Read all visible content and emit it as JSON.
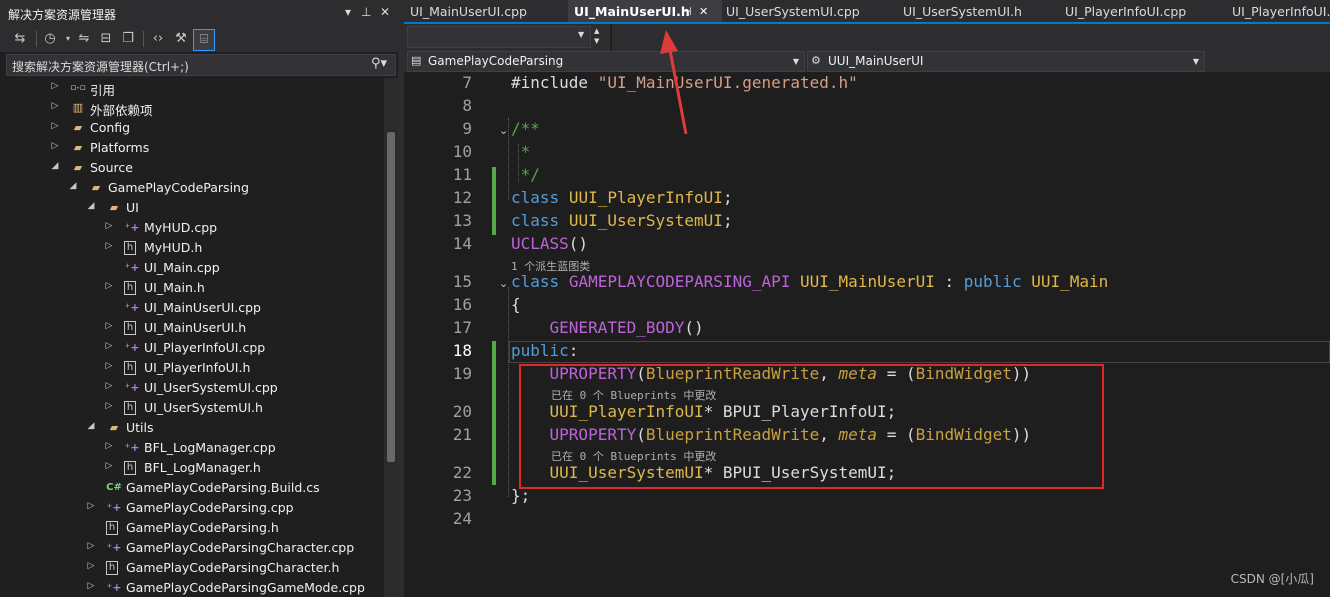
{
  "solution_explorer": {
    "title": "解决方案资源管理器",
    "search_placeholder": "搜索解决方案资源管理器(Ctrl+;)",
    "tree": [
      {
        "label": "引用",
        "icon": "reference-icon",
        "indent": 0,
        "expand": "collapsed"
      },
      {
        "label": "外部依赖项",
        "icon": "external-deps-icon",
        "indent": 0,
        "expand": "collapsed"
      },
      {
        "label": "Config",
        "icon": "folder-icon",
        "indent": 0,
        "expand": "collapsed"
      },
      {
        "label": "Platforms",
        "icon": "folder-icon",
        "indent": 0,
        "expand": "collapsed"
      },
      {
        "label": "Source",
        "icon": "folder-icon",
        "indent": 0,
        "expand": "expanded"
      },
      {
        "label": "GamePlayCodeParsing",
        "icon": "folder-icon",
        "indent": 1,
        "expand": "expanded"
      },
      {
        "label": "UI",
        "icon": "folder-icon",
        "indent": 2,
        "expand": "expanded"
      },
      {
        "label": "MyHUD.cpp",
        "icon": "cpp-file-icon",
        "indent": 3,
        "expand": "collapsed"
      },
      {
        "label": "MyHUD.h",
        "icon": "header-file-icon",
        "indent": 3,
        "expand": "collapsed"
      },
      {
        "label": "UI_Main.cpp",
        "icon": "cpp-file-icon",
        "indent": 3,
        "expand": "none"
      },
      {
        "label": "UI_Main.h",
        "icon": "header-file-icon",
        "indent": 3,
        "expand": "collapsed"
      },
      {
        "label": "UI_MainUserUI.cpp",
        "icon": "cpp-file-icon",
        "indent": 3,
        "expand": "none"
      },
      {
        "label": "UI_MainUserUI.h",
        "icon": "header-file-icon",
        "indent": 3,
        "expand": "collapsed"
      },
      {
        "label": "UI_PlayerInfoUI.cpp",
        "icon": "cpp-file-icon",
        "indent": 3,
        "expand": "collapsed"
      },
      {
        "label": "UI_PlayerInfoUI.h",
        "icon": "header-file-icon",
        "indent": 3,
        "expand": "collapsed"
      },
      {
        "label": "UI_UserSystemUI.cpp",
        "icon": "cpp-file-icon",
        "indent": 3,
        "expand": "collapsed"
      },
      {
        "label": "UI_UserSystemUI.h",
        "icon": "header-file-icon",
        "indent": 3,
        "expand": "collapsed"
      },
      {
        "label": "Utils",
        "icon": "folder-icon",
        "indent": 2,
        "expand": "expanded"
      },
      {
        "label": "BFL_LogManager.cpp",
        "icon": "cpp-file-icon",
        "indent": 3,
        "expand": "collapsed"
      },
      {
        "label": "BFL_LogManager.h",
        "icon": "header-file-icon",
        "indent": 3,
        "expand": "collapsed"
      },
      {
        "label": "GamePlayCodeParsing.Build.cs",
        "icon": "csharp-file-icon",
        "indent": 2,
        "expand": "none"
      },
      {
        "label": "GamePlayCodeParsing.cpp",
        "icon": "cpp-file-icon",
        "indent": 2,
        "expand": "collapsed"
      },
      {
        "label": "GamePlayCodeParsing.h",
        "icon": "header-file-icon",
        "indent": 2,
        "expand": "none"
      },
      {
        "label": "GamePlayCodeParsingCharacter.cpp",
        "icon": "cpp-file-icon",
        "indent": 2,
        "expand": "collapsed"
      },
      {
        "label": "GamePlayCodeParsingCharacter.h",
        "icon": "header-file-icon",
        "indent": 2,
        "expand": "collapsed"
      },
      {
        "label": "GamePlayCodeParsingGameMode.cpp",
        "icon": "cpp-file-icon",
        "indent": 2,
        "expand": "collapsed"
      }
    ]
  },
  "tabs": [
    {
      "label": "UI_MainUserUI.cpp",
      "active": false
    },
    {
      "label": "UI_MainUserUI.h",
      "active": true
    },
    {
      "label": "UI_UserSystemUI.cpp",
      "active": false
    },
    {
      "label": "UI_UserSystemUI.h",
      "active": false
    },
    {
      "label": "UI_PlayerInfoUI.cpp",
      "active": false
    },
    {
      "label": "UI_PlayerInfoUI.h",
      "active": false
    }
  ],
  "nav": {
    "project": "GamePlayCodeParsing",
    "scope": "UUI_MainUserUI"
  },
  "code_lines": [
    {
      "n": "7",
      "html": "<span>#include </span><span class=\"str\">\"UI_MainUserUI.generated.h\"</span>"
    },
    {
      "n": "8",
      "html": ""
    },
    {
      "n": "9",
      "html": "<span class=\"cm\">/**</span>"
    },
    {
      "n": "10",
      "html": "<span class=\"cm\"> *</span>"
    },
    {
      "n": "11",
      "html": "<span class=\"cm\"> */</span>"
    },
    {
      "n": "12",
      "html": "<span class=\"kw\">class</span> <span class=\"ty\">UUI_PlayerInfoUI</span>;"
    },
    {
      "n": "13",
      "html": "<span class=\"kw\">class</span> <span class=\"ty\">UUI_UserSystemUI</span>;"
    },
    {
      "n": "14",
      "html": "<span class=\"mac\">UCLASS</span>()"
    },
    {
      "n": "15",
      "html": "<span class=\"kw\">class</span> <span class=\"mac\">GAMEPLAYCODEPARSING_API</span> <span class=\"ty\">UUI_MainUserUI</span> : <span class=\"kw\">public</span> <span class=\"ty\">UUI_Main</span>"
    },
    {
      "n": "16",
      "html": "{"
    },
    {
      "n": "17",
      "html": "    <span class=\"mac\">GENERATED_BODY</span>()"
    },
    {
      "n": "18",
      "html": "<span class=\"kw\">public</span>:"
    },
    {
      "n": "19",
      "html": "    <span class=\"mac\">UPROPERTY</span>(<span class=\"prm\" style=\"font-style:normal\">BlueprintReadWrite</span>, <span class=\"prm\">meta</span> = (<span class=\"prm\" style=\"font-style:normal\">BindWidget</span>))"
    },
    {
      "n": "20",
      "html": "    <span class=\"ty\">UUI_PlayerInfoUI</span>* BPUI_PlayerInfoUI;"
    },
    {
      "n": "21",
      "html": "    <span class=\"mac\">UPROPERTY</span>(<span class=\"prm\" style=\"font-style:normal\">BlueprintReadWrite</span>, <span class=\"prm\">meta</span> = (<span class=\"prm\" style=\"font-style:normal\">BindWidget</span>))"
    },
    {
      "n": "22",
      "html": "    <span class=\"ty\">UUI_UserSystemUI</span>* BPUI_UserSystemUI;"
    },
    {
      "n": "23",
      "html": "};"
    },
    {
      "n": "24",
      "html": ""
    }
  ],
  "hints": {
    "derived": "1 个派生蓝图类",
    "bp_changes_1": "已在 0 个 Blueprints 中更改",
    "bp_changes_2": "已在 0 个 Blueprints 中更改"
  },
  "watermark": "CSDN @[小瓜]",
  "colors": {
    "accent": "#007acc",
    "highlight_box": "#e02828",
    "arrow": "#e03a3a"
  }
}
